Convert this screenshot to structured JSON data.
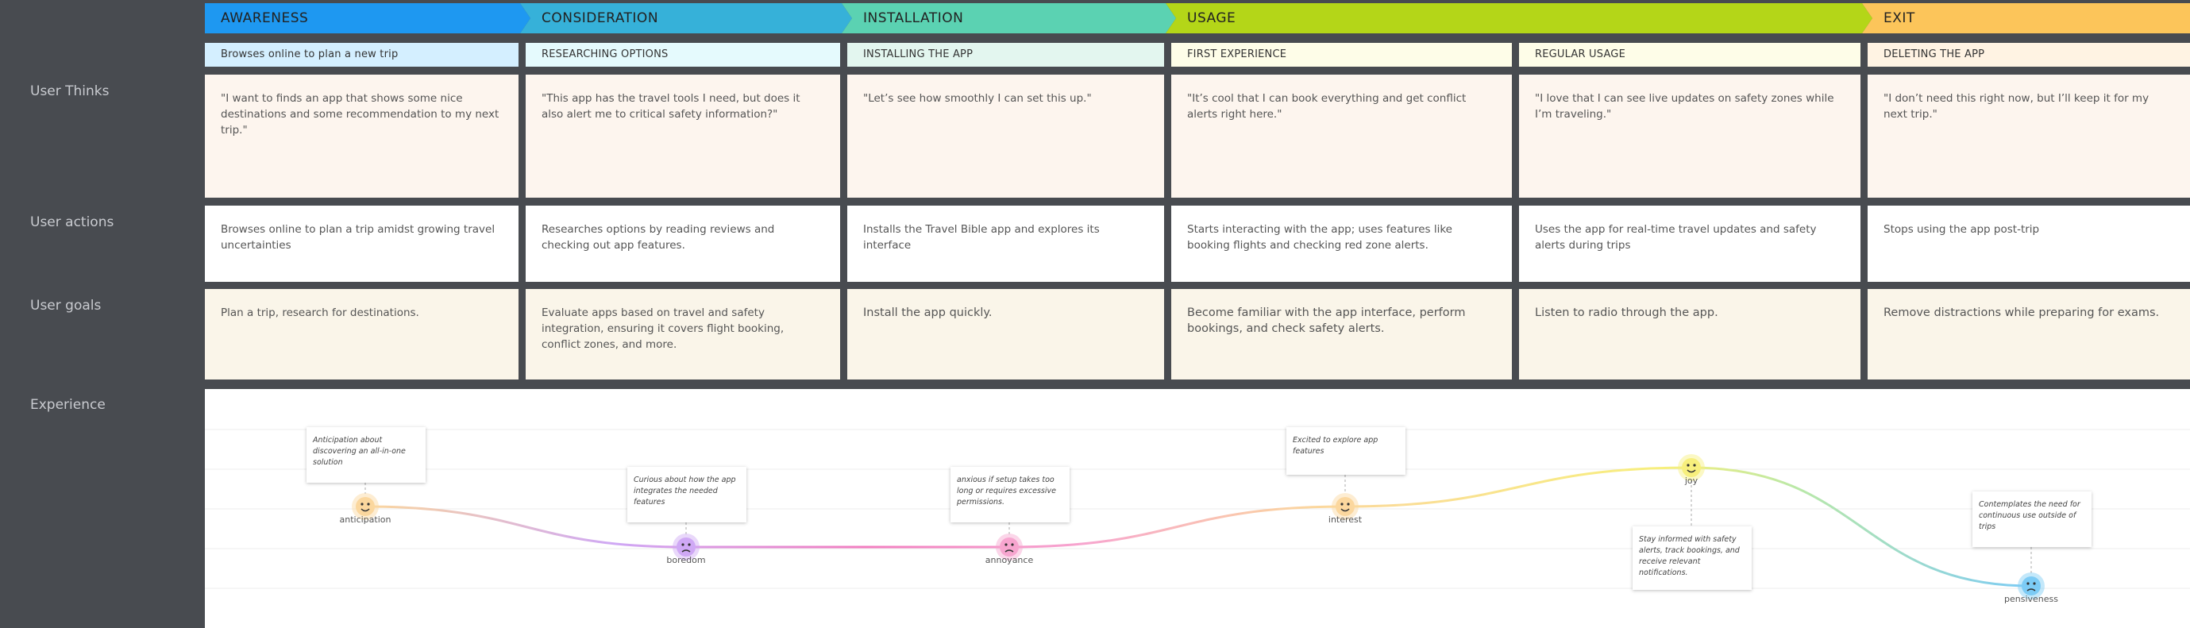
{
  "side_labels": {
    "thinks": "User Thinks",
    "actions": "User actions",
    "goals": "User goals",
    "experience": "Experience"
  },
  "phases": [
    {
      "label": "AWARENESS",
      "color": "#1e98f1"
    },
    {
      "label": "CONSIDERATION",
      "color": "#36b1d9"
    },
    {
      "label": "INSTALLATION",
      "color": "#5bd2b2"
    },
    {
      "label": "USAGE",
      "color": "#b4d618"
    },
    {
      "label": "EXIT",
      "color": "#fcc55a"
    }
  ],
  "stages": [
    {
      "label": "Browses online to plan a new trip",
      "color": "#d4efff",
      "thinks": "\"I want to finds an app that shows some nice destinations and some recommendation to my next trip.\"",
      "actions": "Browses online to plan a trip amidst growing travel uncertainties",
      "goals": "Plan a trip, research for destinations."
    },
    {
      "label": "RESEARCHING OPTIONS",
      "color": "#e5fafd",
      "thinks": "\"This app has the travel tools I need, but does it also alert me to critical safety information?\"",
      "actions": "Researches options by reading reviews and checking out app features.",
      "goals": "Evaluate apps based on travel and safety integration, ensuring it covers flight booking, conflict zones, and more."
    },
    {
      "label": "INSTALLING THE APP",
      "color": "#e3f6ef",
      "thinks": "\"Let’s see how smoothly I can set this up.\"",
      "actions": "Installs the Travel Bible app and explores its interface",
      "goals": "Install the app quickly."
    },
    {
      "label": "FIRST EXPERIENCE",
      "color": "#fefde8",
      "thinks": "\"It’s cool that I can book everything and get conflict alerts right here.\"",
      "actions": " Starts interacting with the app; uses features like booking flights and checking red zone alerts.",
      "goals": "Become familiar with the app interface, perform bookings, and check safety alerts."
    },
    {
      "label": "REGULAR USAGE",
      "color": "#fefde8",
      "thinks": "\"I love that I can see live updates on safety zones while I’m traveling.\"",
      "actions": "Uses the app for real-time travel updates and safety alerts during trips",
      "goals": "Listen to radio through the app."
    },
    {
      "label": "DELETING THE APP",
      "color": "#fff3e3",
      "thinks": "\"I don’t need this right now, but I’ll keep it for my next trip.\"",
      "actions": "Stops using the app post-trip",
      "goals": "Remove distractions while preparing for exams."
    }
  ],
  "emotions": [
    {
      "emotion": "anticipation",
      "note": "Anticipation about discovering an all-in-one solution",
      "color": "#fbd79e"
    },
    {
      "emotion": "boredom",
      "note": "Curious about how the app integrates the needed features",
      "color": "#cfa8f5"
    },
    {
      "emotion": "annoyance",
      "note": "anxious if setup takes too long or requires excessive permissions.",
      "color": "#f7a5cf"
    },
    {
      "emotion": "interest",
      "note": "Excited to explore app features",
      "color": "#fbd79e"
    },
    {
      "emotion": "joy",
      "note": "Stay informed with safety alerts, track bookings, and receive relevant notifications.",
      "color": "#f7ef7d"
    },
    {
      "emotion": "pensiveness",
      "note": "Contemplates the need for continuous use outside of trips",
      "color": "#7ccbf5"
    }
  ]
}
